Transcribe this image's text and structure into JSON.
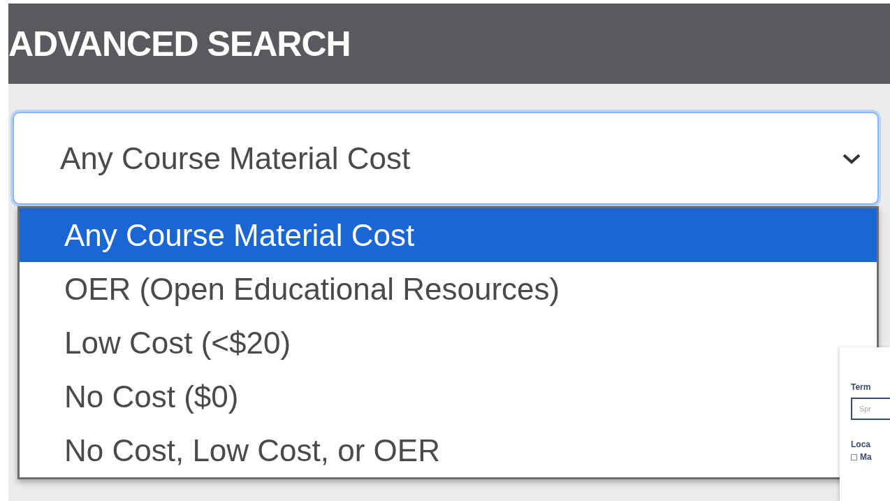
{
  "header": {
    "title": "ADVANCED SEARCH"
  },
  "cost_select": {
    "value": "Any Course Material Cost",
    "expanded": true,
    "options": [
      {
        "label": "Any Course Material Cost",
        "selected": true
      },
      {
        "label": "OER (Open Educational Resources)",
        "selected": false
      },
      {
        "label": "Low Cost (<$20)",
        "selected": false
      },
      {
        "label": "No Cost ($0)",
        "selected": false
      },
      {
        "label": "No Cost, Low Cost, or OER",
        "selected": false
      }
    ]
  },
  "inset": {
    "term_label": "Term",
    "term_placeholder": "Spr",
    "location_label": "Loca",
    "location_option": {
      "label": "Ma",
      "checked": false
    }
  }
}
